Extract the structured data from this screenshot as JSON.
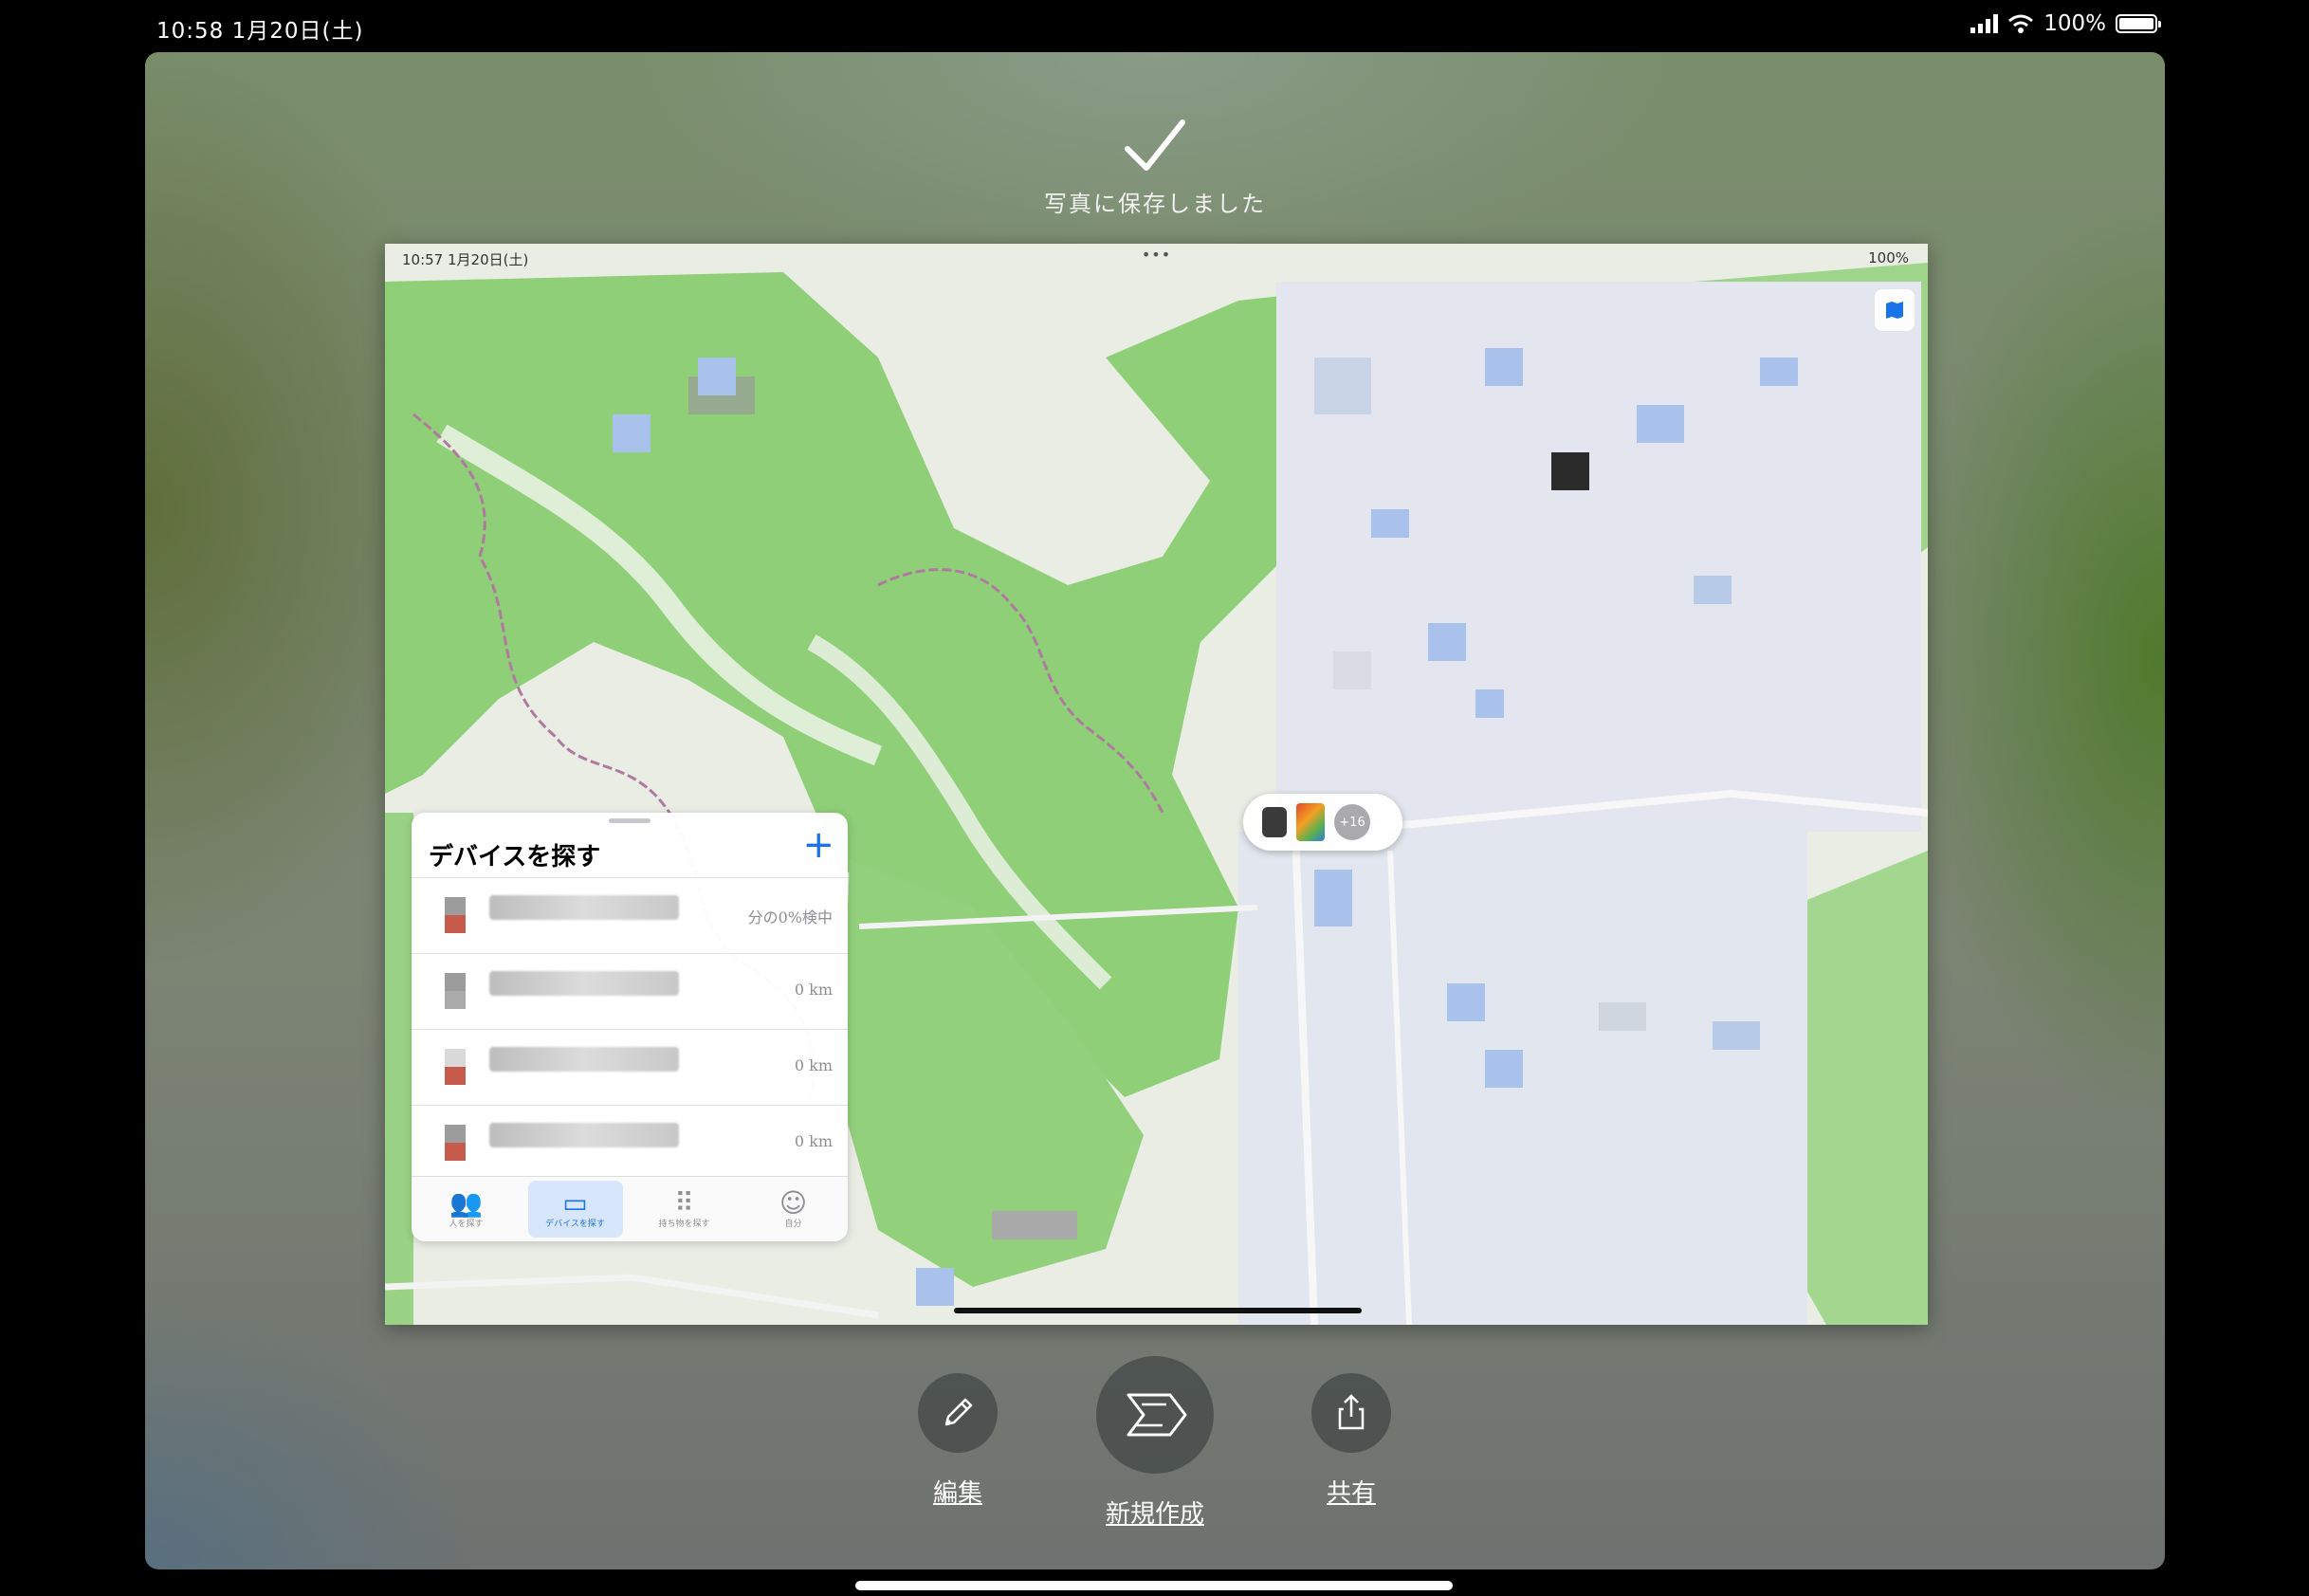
{
  "status_bar": {
    "time_date": "10:58  1月20日(土)",
    "battery": "100%"
  },
  "toast": {
    "text": "写真に保存しました"
  },
  "screenshot": {
    "status_time": "10:57  1月20日(土)",
    "status_dots": "•••",
    "status_battery": "100%",
    "panel": {
      "title": "デバイスを探す",
      "add_label": "+",
      "devices": [
        {
          "distance": "分の0%検中"
        },
        {
          "distance": "0 km"
        },
        {
          "distance": "0 km"
        },
        {
          "distance": "0 km"
        }
      ],
      "tabs": [
        {
          "glyph": "👥",
          "label": "人を探す"
        },
        {
          "glyph": "▭",
          "label": "デバイスを探す"
        },
        {
          "glyph": "⠿",
          "label": "持ち物を探す"
        },
        {
          "glyph": "☺",
          "label": "自分"
        }
      ]
    },
    "cluster": {
      "count": "+16"
    }
  },
  "actions": {
    "edit": "編集",
    "new": "新規作成",
    "share": "共有"
  }
}
